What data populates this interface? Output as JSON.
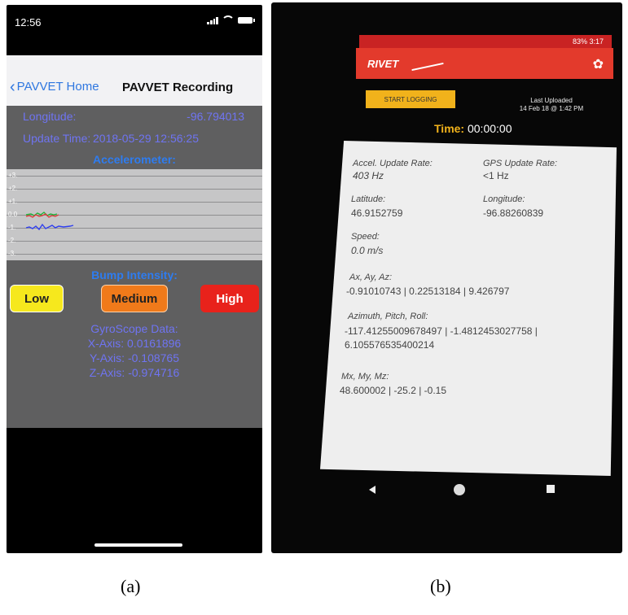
{
  "phone_a": {
    "status_time": "12:56",
    "back_label": "PAVVET Home",
    "title": "PAVVET Recording",
    "longitude_label": "Longitude:",
    "longitude_value": "-96.794013",
    "update_label": "Update Time:",
    "update_value": "2018-05-29 12:56:25",
    "accel_title": "Accelerometer:",
    "ticks": [
      "+3.",
      "+2.",
      "+1.",
      "0.0",
      "-1.",
      "-2.",
      "-3."
    ],
    "bump_title": "Bump Intensity:",
    "buttons": {
      "low": "Low",
      "medium": "Medium",
      "high": "High"
    },
    "colors": {
      "low": "#f6e81d",
      "medium": "#f07a1a",
      "high": "#e8221b",
      "text_blue": "#6f74f2"
    },
    "gyro_title": "GyroScope Data:",
    "gyro_x": "X-Axis: 0.0161896",
    "gyro_y": "Y-Axis: -0.108765",
    "gyro_z": "Z-Axis: -0.974716"
  },
  "phone_b": {
    "status_text": "83% 3:17",
    "app_name": "RIVET",
    "start_label": "START LOGGING",
    "last_uploaded_label": "Last Uploaded",
    "last_uploaded_value": "14 Feb 18 @ 1:42 PM",
    "time_label": "Time:",
    "time_value": "00:00:00",
    "accel_rate_label": "Accel. Update Rate:",
    "accel_rate_value": "403 Hz",
    "gps_rate_label": "GPS Update Rate:",
    "gps_rate_value": "<1 Hz",
    "latitude_label": "Latitude:",
    "latitude_value": "46.9152759",
    "longitude_label": "Longitude:",
    "longitude_value": "-96.88260839",
    "speed_label": "Speed:",
    "speed_value": "0.0 m/s",
    "axyz_label": "Ax, Ay, Az:",
    "axyz_value": "-0.91010743 | 0.22513184 | 9.426797",
    "apr_label": "Azimuth, Pitch, Roll:",
    "apr_value_1": "-117.41255009678497 | -1.4812453027758 |",
    "apr_value_2": "6.105576535400214",
    "mxyz_label": "Mx, My, Mz:",
    "mxyz_value": "48.600002 | -25.2 | -0.15"
  },
  "captions": {
    "a": "(a)",
    "b": "(b)"
  }
}
